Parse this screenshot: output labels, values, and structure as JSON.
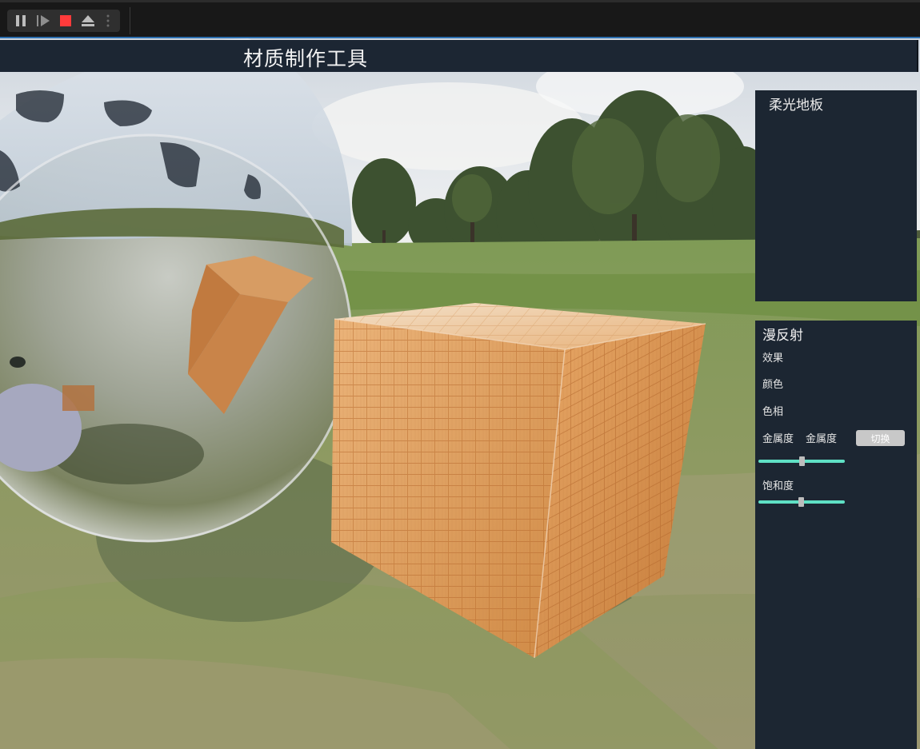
{
  "toolbar": {
    "buttons": [
      {
        "name": "pause-icon"
      },
      {
        "name": "step-icon"
      },
      {
        "name": "stop-icon",
        "color": "#ff3b3b"
      },
      {
        "name": "eject-icon"
      },
      {
        "name": "more-vertical-icon"
      }
    ]
  },
  "app": {
    "title": "材质制作工具"
  },
  "preview_panel": {
    "title": "柔光地板"
  },
  "properties_panel": {
    "section_title": "漫反射",
    "effect_label": "效果",
    "color_label": "颜色",
    "hue_label": "色相",
    "metallic_label": "金属度",
    "metallic_value_label": "金属度",
    "toggle_button": "切换",
    "metallic_slider_value": 0.5,
    "saturation_label": "饱和度",
    "saturation_slider_value": 0.49
  },
  "colors": {
    "accent": "#5fe0c5",
    "panel_bg": "#1c2632",
    "stop_red": "#ff3b3b"
  }
}
